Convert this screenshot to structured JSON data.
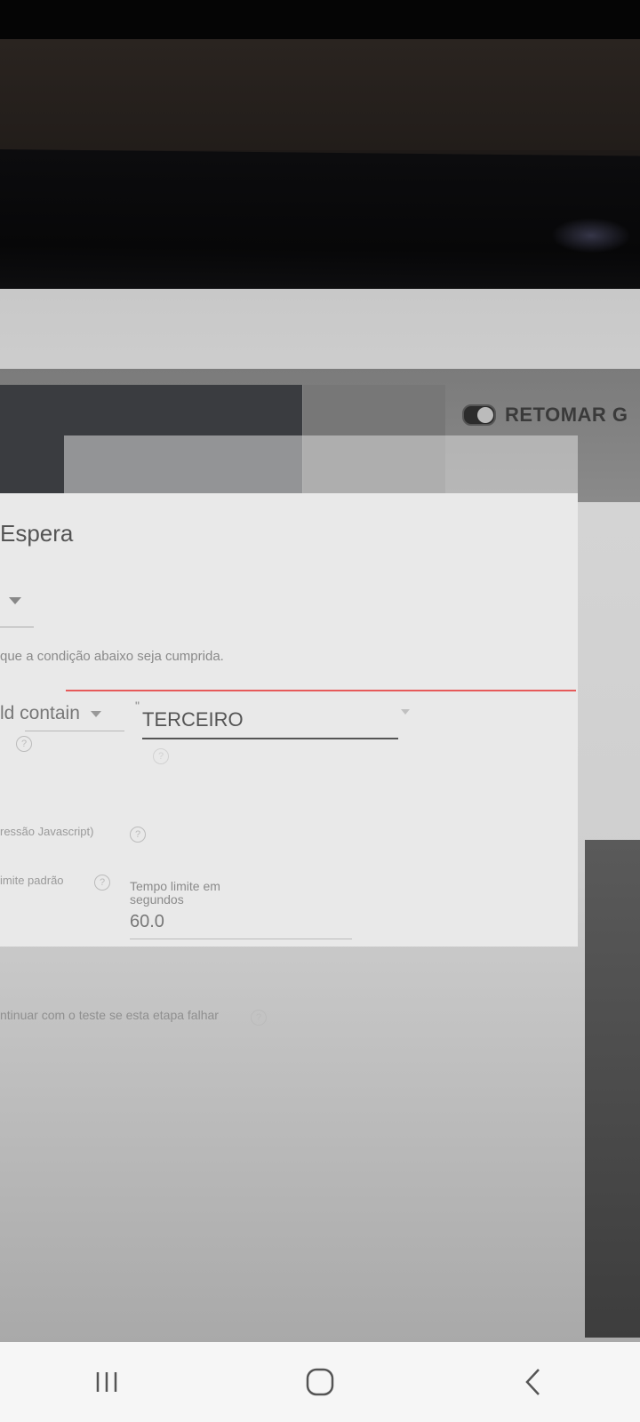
{
  "header": {
    "resume_button_label": "RETOMAR G"
  },
  "dialog": {
    "title": "Espera",
    "condition_hint": "que a condição abaixo seja cumprida.",
    "operator_label": "ld contain",
    "value_input": "TERCEIRO",
    "expression_label": "ressão Javascript)",
    "default_limit_label": "imite padrão",
    "timeout_label": "Tempo limite em segundos",
    "timeout_value": "60.0",
    "continue_label": "ntinuar com o teste se esta etapa falhar"
  },
  "nav": {
    "recent_icon": "recent-apps-icon",
    "home_icon": "home-icon",
    "back_icon": "back-icon"
  }
}
